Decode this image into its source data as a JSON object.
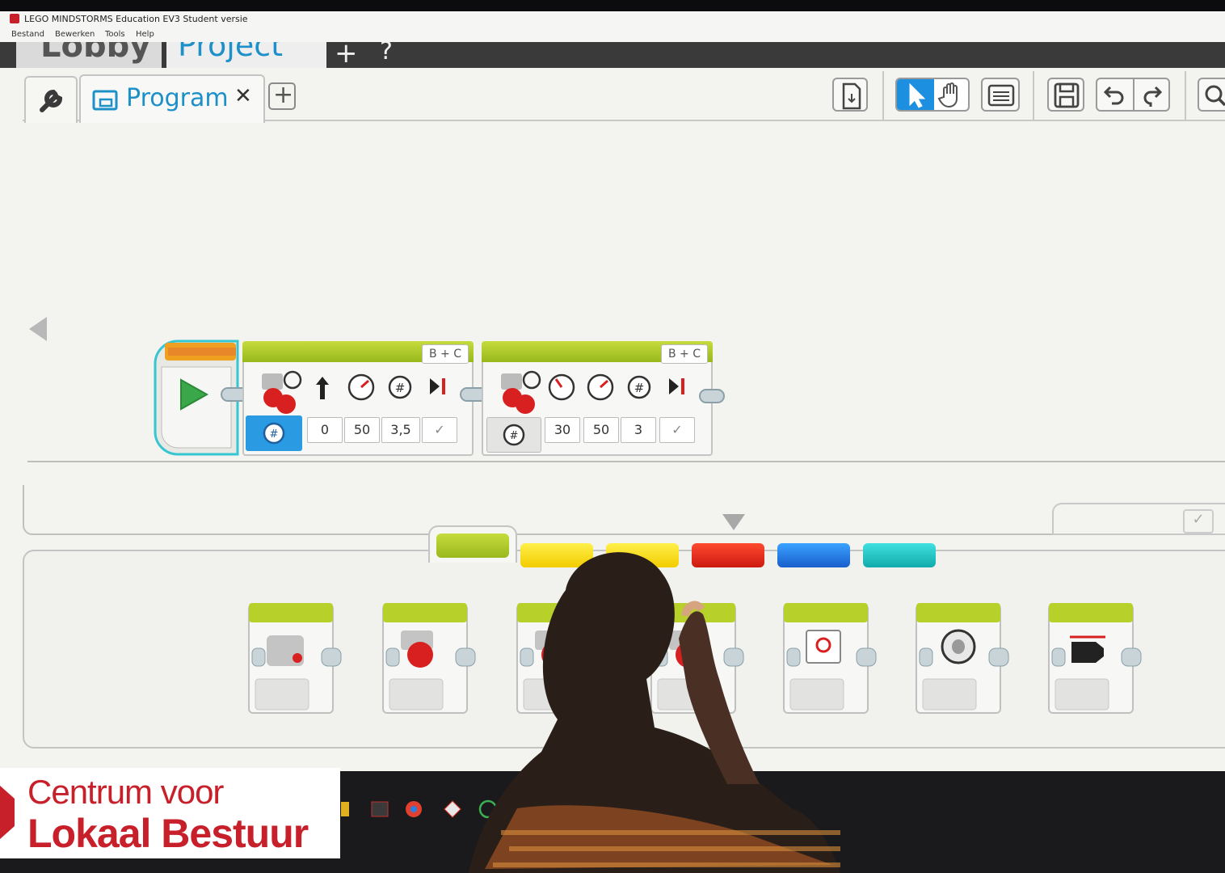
{
  "window": {
    "title": "LEGO MINDSTORMS Education EV3 Student versie"
  },
  "menu": [
    "Bestand",
    "Bewerken",
    "Tools",
    "Help"
  ],
  "project_tabs": {
    "lobby_label": "Lobby",
    "project_label": "Project",
    "project_modified_mark": "*",
    "add_label": "+",
    "help_label": "?"
  },
  "program_tab": {
    "label": "Program",
    "close_label": "✕",
    "add_label": "+"
  },
  "toolbar": [
    "download-icon",
    "pointer-icon",
    "pan-hand-icon",
    "comment-icon",
    "save-icon",
    "undo-icon",
    "redo-icon",
    "zoom-icon"
  ],
  "program": {
    "start_block": "play-icon",
    "blocks": [
      {
        "port": "B + C",
        "type": "move-steering",
        "mode": "degrees",
        "param_icons": [
          "steering-arrow-icon",
          "power-gauge-icon",
          "degrees-icon",
          "brake-icon"
        ],
        "values": [
          "0",
          "50",
          "3,5",
          "✓"
        ]
      },
      {
        "port": "B + C",
        "type": "move-tank",
        "mode": "degrees",
        "param_icons": [
          "power-gauge-icon",
          "power-gauge-icon",
          "degrees-icon",
          "brake-icon"
        ],
        "values": [
          "30",
          "50",
          "3",
          "✓"
        ]
      }
    ]
  },
  "palette": {
    "tabs": [
      {
        "name": "action",
        "color": "#b5d21e",
        "selected": true
      },
      {
        "name": "flow-control",
        "color": "#f6d400"
      },
      {
        "name": "sensor",
        "color": "#f6d400"
      },
      {
        "name": "data-operations",
        "color": "#e0261a"
      },
      {
        "name": "advanced",
        "color": "#2a7fe0"
      },
      {
        "name": "my-blocks",
        "color": "#1cc6c6"
      }
    ],
    "blocks": [
      "medium-motor",
      "large-motor",
      "move-steering",
      "move-tank",
      "display",
      "sound",
      "brick-status-light"
    ]
  },
  "overlay": {
    "line1": "Centrum voor",
    "line2": "Lokaal Bestuur"
  }
}
